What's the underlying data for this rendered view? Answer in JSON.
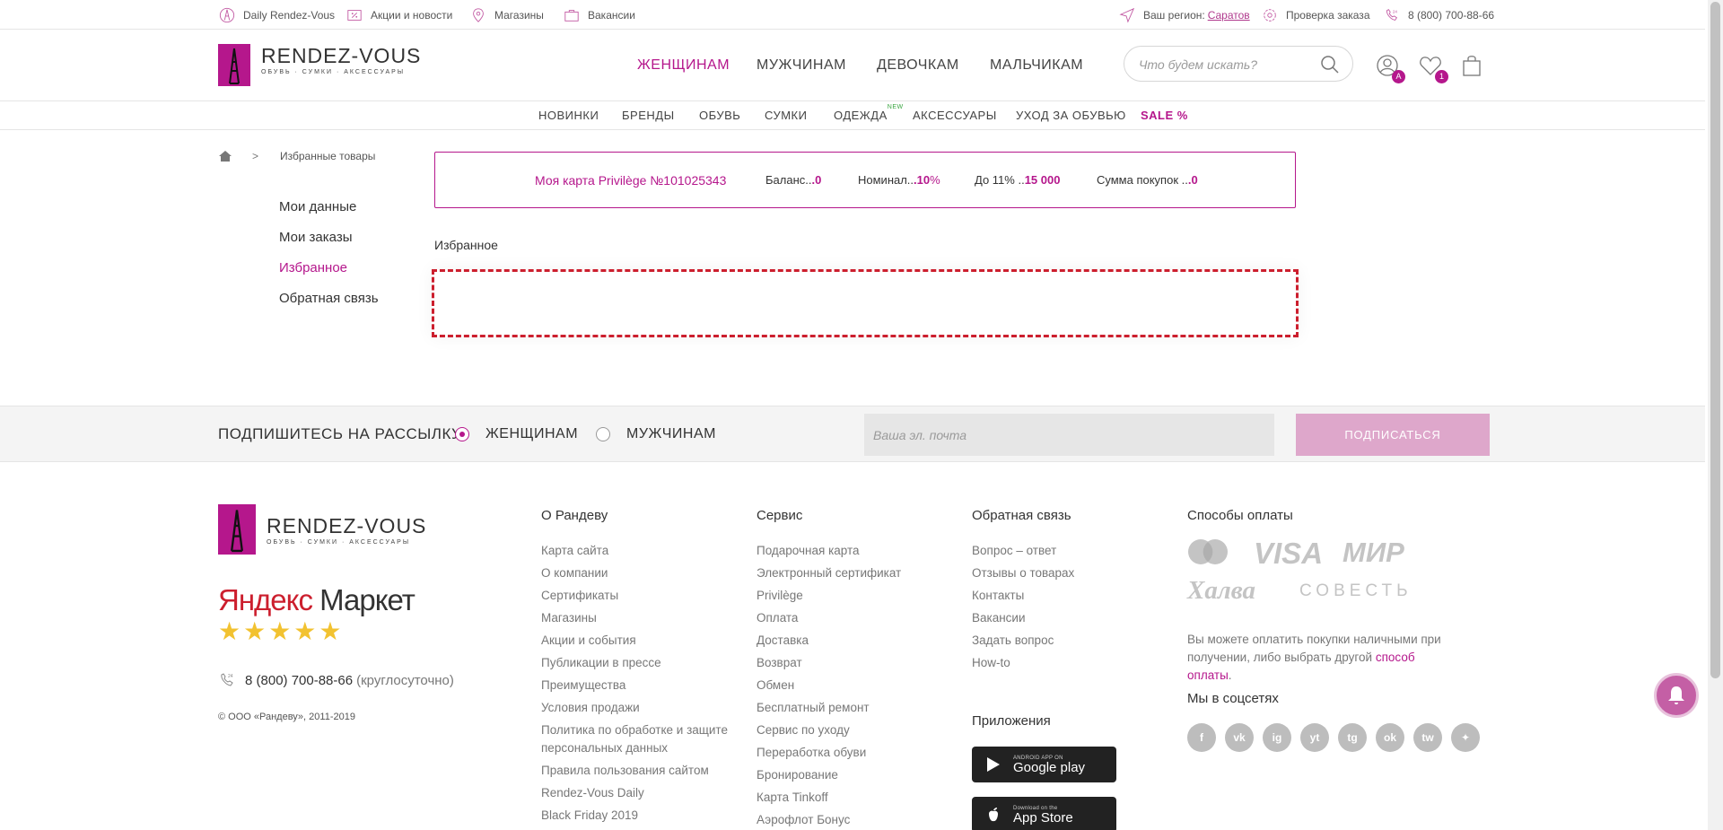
{
  "topbar": {
    "daily": "Daily Rendez-Vous",
    "promos": "Акции и новости",
    "stores": "Магазины",
    "jobs": "Вакансии",
    "region_label": "Ваш регион:",
    "region_value": "Саратов",
    "order_check": "Проверка заказа",
    "phone": "8 (800) 700-88-66",
    "accent_color": "#b5178c"
  },
  "logo": {
    "title": "RENDEZ-VOUS",
    "subtitle": "ОБУВЬ · СУМКИ · АКСЕССУАРЫ"
  },
  "mainnav": [
    "ЖЕНЩИНАМ",
    "МУЖЧИНАМ",
    "ДЕВОЧКАМ",
    "МАЛЬЧИКАМ"
  ],
  "search": {
    "placeholder": "Что будем искать?"
  },
  "header_icons": {
    "account_badge": "A",
    "favorites_badge": "1"
  },
  "subnav": {
    "items": [
      "НОВИНКИ",
      "БРЕНДЫ",
      "ОБУВЬ",
      "СУМКИ",
      "ОДЕЖДА",
      "АКСЕССУАРЫ",
      "УХОД ЗА ОБУВЬЮ",
      "SALE %"
    ],
    "new_tag": "NEW"
  },
  "breadcrumb": {
    "sep": ">",
    "current": "Избранные товары"
  },
  "sidebar": [
    "Мои данные",
    "Мои заказы",
    "Избранное",
    "Обратная связь"
  ],
  "card": {
    "title": "Моя карта Privilège №101025343",
    "balance_label": "Баланс..",
    "balance_value": ".0",
    "nominal_label": "Номинал..",
    "nominal_value": ".10",
    "nominal_unit": "%",
    "upto_label": "До 11% ..",
    "upto_value": "15 000",
    "sum_label": "Сумма покупок ..",
    "sum_value": ".0"
  },
  "favorites_title": "Избранное",
  "subscribe": {
    "label": "ПОДПИШИТЕСЬ НА РАССЫЛКУ",
    "opt_women": "ЖЕНЩИНАМ",
    "opt_men": "МУЖЧИНАМ",
    "email_placeholder": "Ваша эл. почта",
    "button": "ПОДПИСАТЬСЯ"
  },
  "footer": {
    "ym_ya": "Яндекс",
    "ym_market": "Маркет",
    "stars": "★★★★★",
    "phone": "8 (800) 700-88-66",
    "phone_note": "(круглосуточно)",
    "copyright": "© ООО «Рандеву», 2011-2019",
    "col1": {
      "heading": "О Рандеву",
      "links": [
        "Карта сайта",
        "О компании",
        "Сертификаты",
        "Магазины",
        "Акции и события",
        "Публикации в прессе",
        "Преимущества",
        "Условия продажи",
        "Политика по обработке и защите",
        "персональных данных",
        "Правила пользования сайтом",
        "Rendez-Vous Daily",
        "Black Friday 2019"
      ]
    },
    "col2": {
      "heading": "Сервис",
      "links": [
        "Подарочная карта",
        "Электронный сертификат",
        "Privilège",
        "Оплата",
        "Доставка",
        "Возврат",
        "Обмен",
        "Бесплатный ремонт",
        "Сервис по уходу",
        "Переработка обуви",
        "Бронирование",
        "Карта Tinkoff",
        "Аэрофлот Бонус"
      ]
    },
    "col3": {
      "heading": "Обратная связь",
      "links": [
        "Вопрос – ответ",
        "Отзывы о товарах",
        "Контакты",
        "Вакансии",
        "Задать вопрос",
        "How-to"
      ]
    },
    "apps": {
      "heading": "Приложения",
      "google_small": "ANDROID APP ON",
      "google_big": "Google play",
      "apple_small": "Download on the",
      "apple_big": "App Store"
    },
    "payment": {
      "heading": "Способы оплаты",
      "logos": [
        "VISA",
        "МИР",
        "Халва",
        "СОВЕСТЬ"
      ],
      "note": "Вы можете оплатить покупки наличными при получении, либо выбрать другой",
      "note_link": "способ оплаты",
      "note_end": "."
    },
    "social": {
      "heading": "Мы в соцсетях",
      "icons": [
        "f",
        "vk",
        "ig",
        "yt",
        "tg",
        "ok",
        "tw",
        "✦"
      ]
    }
  }
}
